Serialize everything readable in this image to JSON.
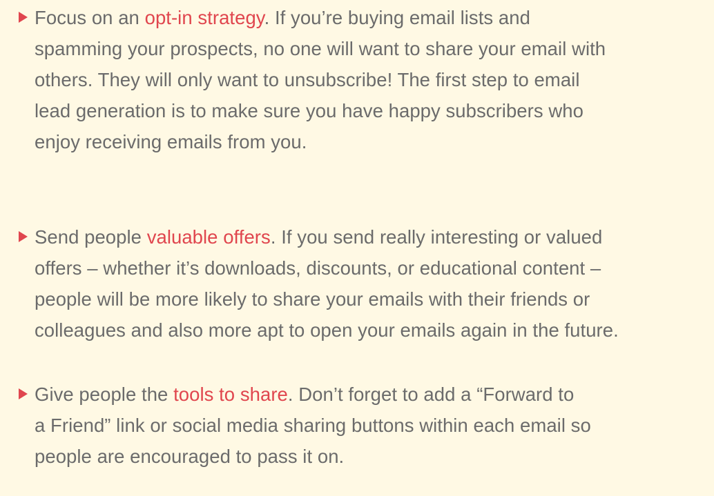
{
  "items": [
    {
      "lead_plain": "Focus on an ",
      "highlight": "opt-in strategy",
      "line1_rest": ". If you’re buying email lists and",
      "lines": [
        "spamming your prospects, no one will want to share your email with",
        "others. They will only want to unsubscribe! The first step to email",
        "lead generation is to make sure you have happy subscribers who",
        "enjoy receiving emails from you."
      ]
    },
    {
      "lead_plain": "Send people ",
      "highlight": "valuable offers",
      "line1_rest": ". If you send really interesting or valued",
      "lines": [
        "offers – whether it’s downloads, discounts, or educational content –",
        "people will be more likely to share your emails with their friends or",
        "colleagues and also more apt to open your emails again in the future."
      ]
    },
    {
      "lead_plain": "Give people the ",
      "highlight": "tools to share",
      "line1_rest": ". Don’t forget to add a “Forward to",
      "lines": [
        "a Friend” link or social media sharing buttons within each email so",
        "people are encouraged to pass it on."
      ]
    }
  ],
  "colors": {
    "background": "#fff9e4",
    "text": "#6b6b6b",
    "accent": "#e0464e"
  }
}
